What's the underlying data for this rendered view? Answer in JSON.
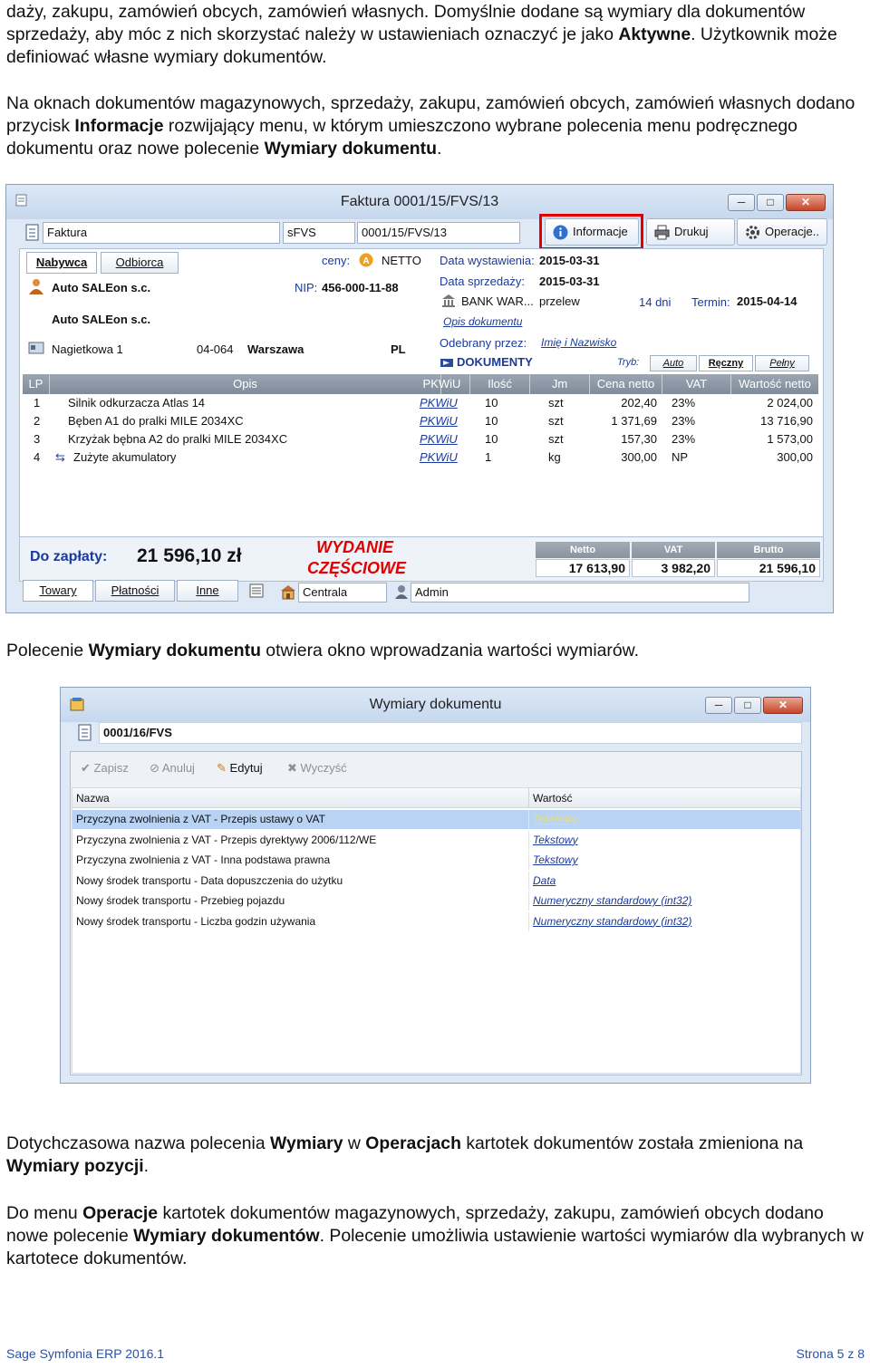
{
  "paragraphs": {
    "p1": {
      "t1": "daży, zakupu, zamówień obcych, zamówień własnych. Domyślnie dodane są wymiary dla dokumentów sprzedaży, aby móc z nich skorzystać należy w ustawieniach oznaczyć je jako ",
      "b1": "Aktywne",
      "t2": ". Użytkownik może definiować własne wymiary dokumentów."
    },
    "p2": {
      "t1": "Na oknach dokumentów magazynowych, sprzedaży, zakupu, zamówień obcych, zamówień własnych dodano przycisk ",
      "b1": "Informacje",
      "t2": " rozwijający menu, w którym umieszczono wybrane polecenia menu podręcznego dokumentu oraz nowe polecenie ",
      "b2": "Wymiary dokumentu",
      "t3": "."
    },
    "p3": {
      "t1": "Polecenie ",
      "b1": "Wymiary dokumentu",
      "t2": " otwiera okno wprowadzania wartości wymiarów."
    },
    "p4": {
      "t1": "Dotychczasowa nazwa polecenia ",
      "b1": "Wymiary",
      "t2": " w ",
      "b2": "Operacjach",
      "t3": " kartotek dokumentów została zmieniona na ",
      "b3": "Wymiary pozycji",
      "t4": "."
    },
    "p5": {
      "t1": "Do menu ",
      "b1": "Operacje",
      "t2": " kartotek dokumentów magazynowych, sprzedaży, zakupu, zamówień obcych dodano nowe polecenie ",
      "b2": "Wymiary dokumentów",
      "t3": ". Polecenie umożliwia ustawienie wartości wymiarów dla wybranych w kartotece dokumentów."
    }
  },
  "faktura": {
    "title": "Faktura 0001/15/FVS/13",
    "doc_type": "Faktura",
    "series": "sFVS",
    "number": "0001/15/FVS/13",
    "buttons": {
      "info": "Informacje",
      "print": "Drukuj",
      "ops": "Operacje.."
    },
    "tabs": {
      "buyer": "Nabywca",
      "receiver": "Odbiorca"
    },
    "buyer": {
      "name1": "Auto SALEon s.c.",
      "name2": "Auto SALEon s.c.",
      "nip_label": "NIP:",
      "nip": "456-000-11-88",
      "street": "Nagietkowa 1",
      "postal": "04-064",
      "city": "Warszawa",
      "country": "PL"
    },
    "prices_label": "ceny:",
    "prices_value": "NETTO",
    "issue_label": "Data wystawienia:",
    "issue_date": "2015-03-31",
    "sale_label": "Data sprzedaży:",
    "sale_date": "2015-03-31",
    "bank": "BANK WAR...",
    "payment": "przelew",
    "days": "14 dni",
    "due_label": "Termin:",
    "due_date": "2015-04-14",
    "doc_desc_link": "Opis dokumentu",
    "received_label": "Odebrany przez:",
    "received_link": "Imię i Nazwisko",
    "dokumenty": "DOKUMENTY",
    "mode_label": "Tryb:",
    "mode_auto": "Auto",
    "mode_manual": "Ręczny",
    "mode_full": "Pełny",
    "table": {
      "headers": [
        "LP",
        "Opis",
        "PKWiU",
        "Ilość",
        "Jm",
        "Cena netto",
        "VAT",
        "Wartość netto"
      ],
      "rows": [
        [
          "1",
          "Silnik odkurzacza Atlas 14",
          "PKWiU",
          "10",
          "szt",
          "202,40",
          "23%",
          "2 024,00"
        ],
        [
          "2",
          "Bęben A1 do pralki MILE 2034XC",
          "PKWiU",
          "10",
          "szt",
          "1 371,69",
          "23%",
          "13 716,90"
        ],
        [
          "3",
          "Krzyżak bębna A2 do pralki MILE 2034XC",
          "PKWiU",
          "10",
          "szt",
          "157,30",
          "23%",
          "1 573,00"
        ],
        [
          "4",
          "Zużyte akumulatory",
          "PKWiU",
          "1",
          "kg",
          "300,00",
          "NP",
          "300,00"
        ]
      ]
    },
    "to_pay_label": "Do zapłaty:",
    "to_pay_value": "21 596,10 zł",
    "stamp_line1": "WYDANIE",
    "stamp_line2": "CZĘŚCIOWE",
    "sums": {
      "netto_label": "Netto",
      "vat_label": "VAT",
      "brutto_label": "Brutto",
      "netto": "17 613,90",
      "vat": "3 982,20",
      "brutto": "21 596,10"
    },
    "bottom_tabs": {
      "towary": "Towary",
      "platnosci": "Płatności",
      "inne": "Inne"
    },
    "department": "Centrala",
    "user": "Admin"
  },
  "wymiary": {
    "title": "Wymiary dokumentu",
    "doc_number": "0001/16/FVS",
    "toolbar": {
      "save": "Zapisz",
      "cancel": "Anuluj",
      "edit": "Edytuj",
      "clear": "Wyczyść"
    },
    "headers": {
      "name": "Nazwa",
      "value": "Wartość"
    },
    "rows": [
      {
        "name": "Przyczyna zwolnienia z VAT - Przepis ustawy o VAT",
        "value": "Tekstowy"
      },
      {
        "name": "Przyczyna zwolnienia z VAT - Przepis dyrektywy 2006/112/WE",
        "value": "Tekstowy"
      },
      {
        "name": "Przyczyna zwolnienia z VAT - Inna podstawa prawna",
        "value": "Tekstowy"
      },
      {
        "name": "Nowy środek transportu - Data dopuszczenia do użytku",
        "value": "Data"
      },
      {
        "name": "Nowy środek transportu - Przebieg pojazdu",
        "value": "Numeryczny standardowy (int32)"
      },
      {
        "name": "Nowy środek transportu - Liczba godzin używania",
        "value": "Numeryczny standardowy (int32)"
      }
    ]
  },
  "footer": {
    "product": "Sage Symfonia ERP 2016.1",
    "page": "Strona 5 z 8"
  },
  "icons": [
    "document-icon",
    "info-icon",
    "printer-icon",
    "gear-icon",
    "person-icon",
    "address-card-icon",
    "warning-icon",
    "bank-icon",
    "arrow-icon",
    "lock-icon",
    "disk-icon",
    "check-icon",
    "cancel-icon",
    "pencil-icon",
    "clear-icon"
  ],
  "colors": {
    "highlight": "#e00000",
    "stamp": "#e00000",
    "link": "#1a3a9c",
    "selection": "#b9d3f5"
  }
}
